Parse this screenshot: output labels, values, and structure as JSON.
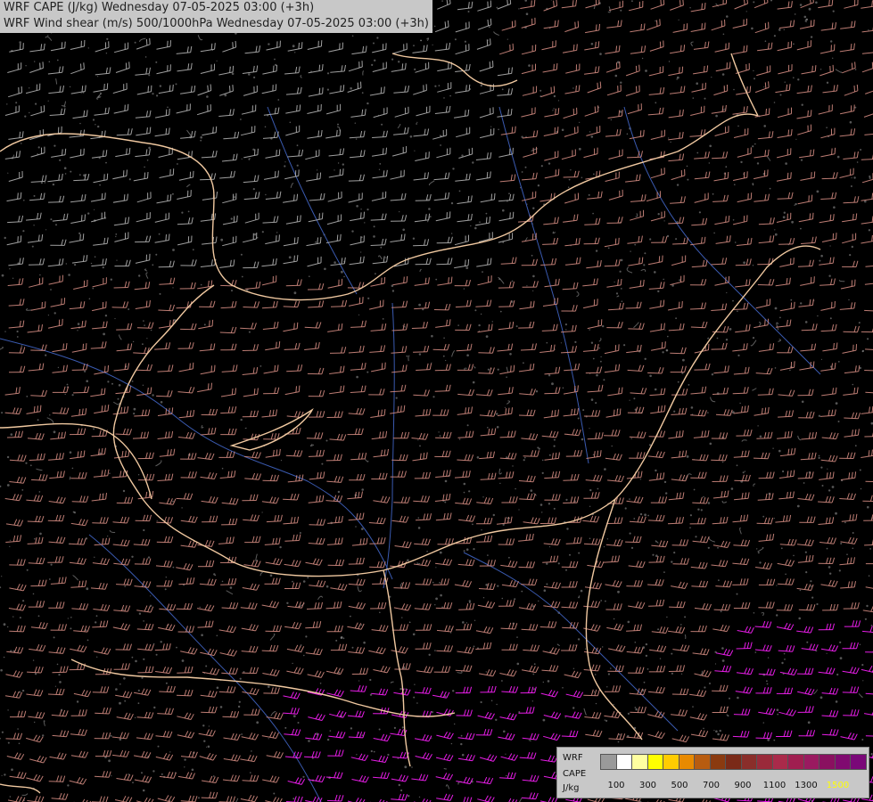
{
  "titles": {
    "line1": "WRF CAPE (J/kg) Wednesday 07-05-2025 03:00 (+3h)",
    "line2": "WRF Wind shear (m/s) 500/1000hPa Wednesday 07-05-2025 03:00 (+3h)"
  },
  "legend": {
    "label1": "WRF",
    "label2": "CAPE",
    "unit": "J/kg",
    "swatches": [
      "#9a9a9a",
      "#ffffff",
      "#ffffa0",
      "#ffff00",
      "#ffcc00",
      "#e88a00",
      "#b85c10",
      "#8a3a10",
      "#7a2a18",
      "#8a2e2a",
      "#9a2a3a",
      "#aa2a4a",
      "#a01e50",
      "#9a1a60",
      "#8a1060",
      "#800a70",
      "#7a0878"
    ],
    "ticks": [
      "100",
      "300",
      "500",
      "700",
      "900",
      "1100",
      "1300",
      "1500"
    ],
    "tick_color_last": "#ffff00"
  },
  "colors": {
    "background": "#000000",
    "border": "#f0c8a0",
    "river": "#3a5ab0",
    "contour": "#9a9a9a",
    "barb_low": "#b0b0b0",
    "barb_mid": "#d08a80",
    "barb_high": "#ff20ff"
  }
}
